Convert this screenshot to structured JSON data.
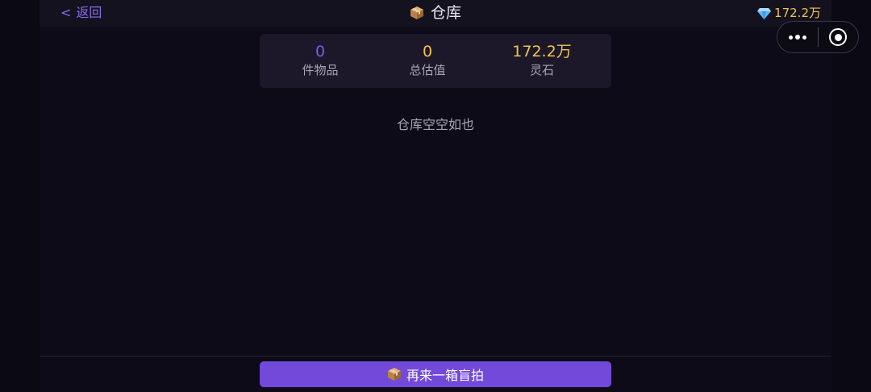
{
  "header": {
    "back_label": "返回",
    "back_chevron": "<",
    "title": "仓库",
    "title_icon": "package-box-icon",
    "balance": "172.2万",
    "balance_icon": "diamond-gem-icon"
  },
  "capsule": {
    "more_icon": "more-dots-icon",
    "close_icon": "target-circle-icon"
  },
  "stats": [
    {
      "value": "0",
      "label": "件物品"
    },
    {
      "value": "0",
      "label": "总估值"
    },
    {
      "value": "172.2万",
      "label": "灵石"
    }
  ],
  "empty_message": "仓库空空如也",
  "cta": {
    "label": "再来一箱盲拍",
    "icon": "package-box-icon"
  },
  "colors": {
    "accent_purple": "#7349da",
    "gold": "#f2c34a",
    "background": "#0e0b18"
  }
}
